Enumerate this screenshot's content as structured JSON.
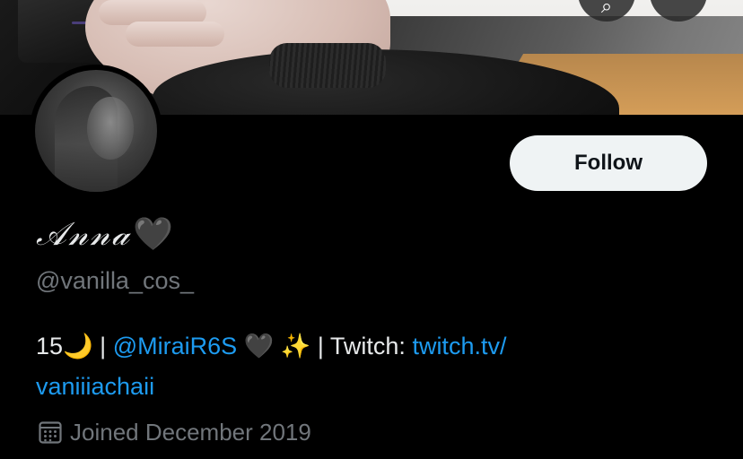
{
  "banner": {
    "search_glyph": "⌕",
    "more_glyph": "",
    "icons": [
      "search-icon",
      "more-icon"
    ]
  },
  "profile": {
    "display_name": "𝒜𝓃𝓃𝒶",
    "name_emoji": "🖤",
    "handle": "@vanilla_cos_",
    "avatar_icon": "avatar-photo"
  },
  "actions": {
    "follow_label": "Follow"
  },
  "bio": {
    "age": "15🌙",
    "separator_1": " | ",
    "mention": "@MiraiR6S",
    "emojis": " 🖤 ✨",
    "separator_2": " | ",
    "twitch_label": "Twitch: ",
    "twitch_link_part1": "twitch.tv/",
    "twitch_link_part2": "vaniiiachaii"
  },
  "meta": {
    "joined": "Joined December 2019",
    "calendar_icon": "calendar-icon"
  },
  "colors": {
    "background": "#000000",
    "primary_text": "#e7e9ea",
    "secondary_text": "#71767b",
    "link": "#1d9bf0",
    "follow_button_bg": "#eff3f4"
  }
}
